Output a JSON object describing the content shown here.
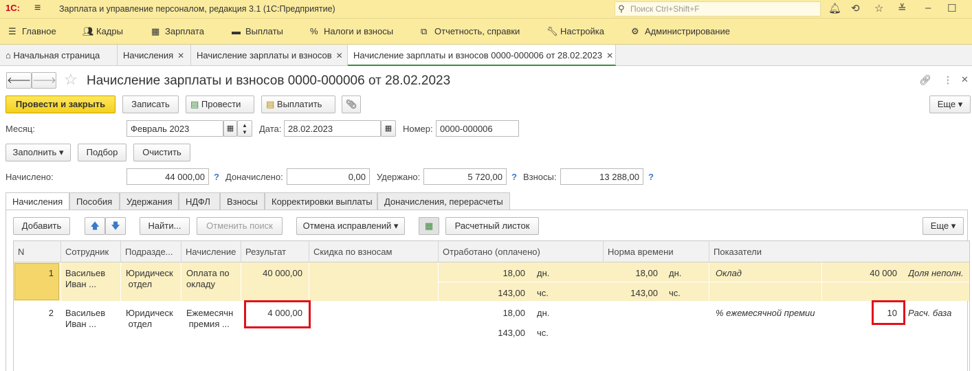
{
  "app": {
    "logo": "1С:",
    "title": "Зарплата и управление персоналом, редакция 3.1  (1С:Предприятие)",
    "search_placeholder": "Поиск Ctrl+Shift+F"
  },
  "menu": [
    {
      "label": "Главное",
      "icon": "hamburger-icon"
    },
    {
      "label": "Кадры",
      "icon": "people-icon"
    },
    {
      "label": "Зарплата",
      "icon": "calculator-icon"
    },
    {
      "label": "Выплаты",
      "icon": "wallet-icon"
    },
    {
      "label": "Налоги и взносы",
      "icon": "percent-icon"
    },
    {
      "label": "Отчетность, справки",
      "icon": "report-icon"
    },
    {
      "label": "Настройка",
      "icon": "wrench-icon"
    },
    {
      "label": "Администрирование",
      "icon": "gear-icon"
    }
  ],
  "tabs": [
    {
      "label": "Начальная страница"
    },
    {
      "label": "Начисления"
    },
    {
      "label": "Начисление зарплаты и взносов"
    },
    {
      "label": "Начисление зарплаты и взносов 0000-000006 от 28.02.2023"
    }
  ],
  "doc": {
    "title": "Начисление зарплаты и взносов 0000-000006 от 28.02.2023",
    "buttons": {
      "post_close": "Провести и закрыть",
      "save": "Записать",
      "post": "Провести",
      "pay": "Выплатить",
      "more": "Еще"
    },
    "month_label": "Месяц:",
    "month_value": "Февраль 2023",
    "date_label": "Дата:",
    "date_value": "28.02.2023",
    "number_label": "Номер:",
    "number_value": "0000-000006",
    "fill_btn": "Заполнить",
    "select_btn": "Подбор",
    "clear_btn": "Очистить",
    "accrued_label": "Начислено:",
    "accrued_value": "44 000,00",
    "extra_label": "Доначислено:",
    "extra_value": "0,00",
    "withheld_label": "Удержано:",
    "withheld_value": "5 720,00",
    "contrib_label": "Взносы:",
    "contrib_value": "13 288,00",
    "help": "?"
  },
  "doc_tabs": [
    "Начисления",
    "Пособия",
    "Удержания",
    "НДФЛ",
    "Взносы",
    "Корректировки выплаты",
    "Доначисления, перерасчеты"
  ],
  "table_toolbar": {
    "add": "Добавить",
    "find": "Найти...",
    "cancel_search": "Отменить поиск",
    "cancel_fixes": "Отмена исправлений",
    "payslip": "Расчетный листок",
    "more": "Еще"
  },
  "table": {
    "headers": [
      "N",
      "Сотрудник",
      "Подразде...",
      "Начисление",
      "Результат",
      "Скидка по взносам",
      "Отработано (оплачено)",
      "Норма времени",
      "Показатели"
    ],
    "rows": [
      {
        "n": "1",
        "employee": [
          "Васильев",
          "Иван ..."
        ],
        "dept": [
          "Юридическ",
          "отдел"
        ],
        "accrual": [
          "Оплата по",
          "окладу"
        ],
        "result": "40 000,00",
        "worked_days": "18,00",
        "worked_days_unit": "дн.",
        "worked_hours": "143,00",
        "worked_hours_unit": "чс.",
        "norm_days": "18,00",
        "norm_days_unit": "дн.",
        "norm_hours": "143,00",
        "norm_hours_unit": "чс.",
        "indicator": "Оклад",
        "indicator_value": "40 000",
        "indicator2": "Доля неполн."
      },
      {
        "n": "2",
        "employee": [
          "Васильев",
          "Иван ..."
        ],
        "dept": [
          "Юридическ",
          "отдел"
        ],
        "accrual": [
          "Ежемесячн",
          "премия ..."
        ],
        "result": "4 000,00",
        "worked_days": "18,00",
        "worked_days_unit": "дн.",
        "worked_hours": "143,00",
        "worked_hours_unit": "чс.",
        "indicator": "% ежемесячной премии",
        "indicator_value": "10",
        "indicator2": "Расч. база"
      }
    ]
  }
}
